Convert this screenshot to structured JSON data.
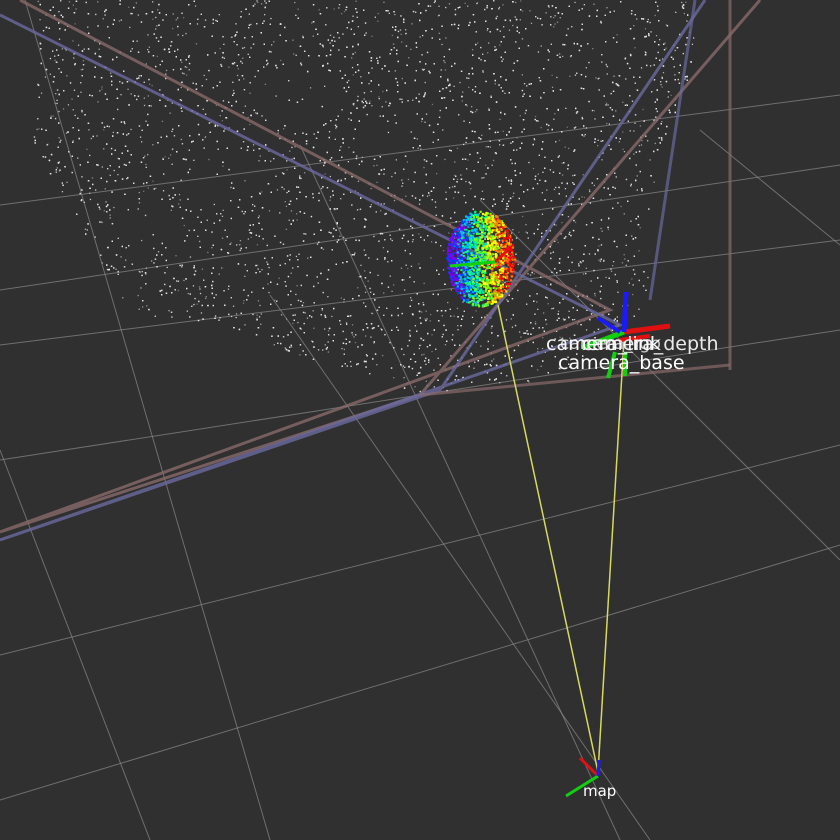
{
  "viewport": {
    "background": "#303030",
    "grid_color": "#8a8a8a",
    "point_color": "#e6e6e6"
  },
  "tf_frames": {
    "overlapping_labels": [
      "camera_link",
      "camera_depth",
      "camera_rgb"
    ],
    "base_label": "camera_base",
    "map_label": "map",
    "axis_colors": {
      "x": "#e01010",
      "y": "#10d010",
      "z": "#1a1aff"
    },
    "link_color": "#d8d860"
  },
  "bounding_boxes": [
    {
      "color": "#8a6a6a"
    },
    {
      "color": "#6a6aa0"
    }
  ],
  "colored_cluster": {
    "colors": [
      "#8000ff",
      "#0040ff",
      "#00c0ff",
      "#00ff80",
      "#80ff00",
      "#ffff00",
      "#ff8000",
      "#ff0000"
    ]
  }
}
